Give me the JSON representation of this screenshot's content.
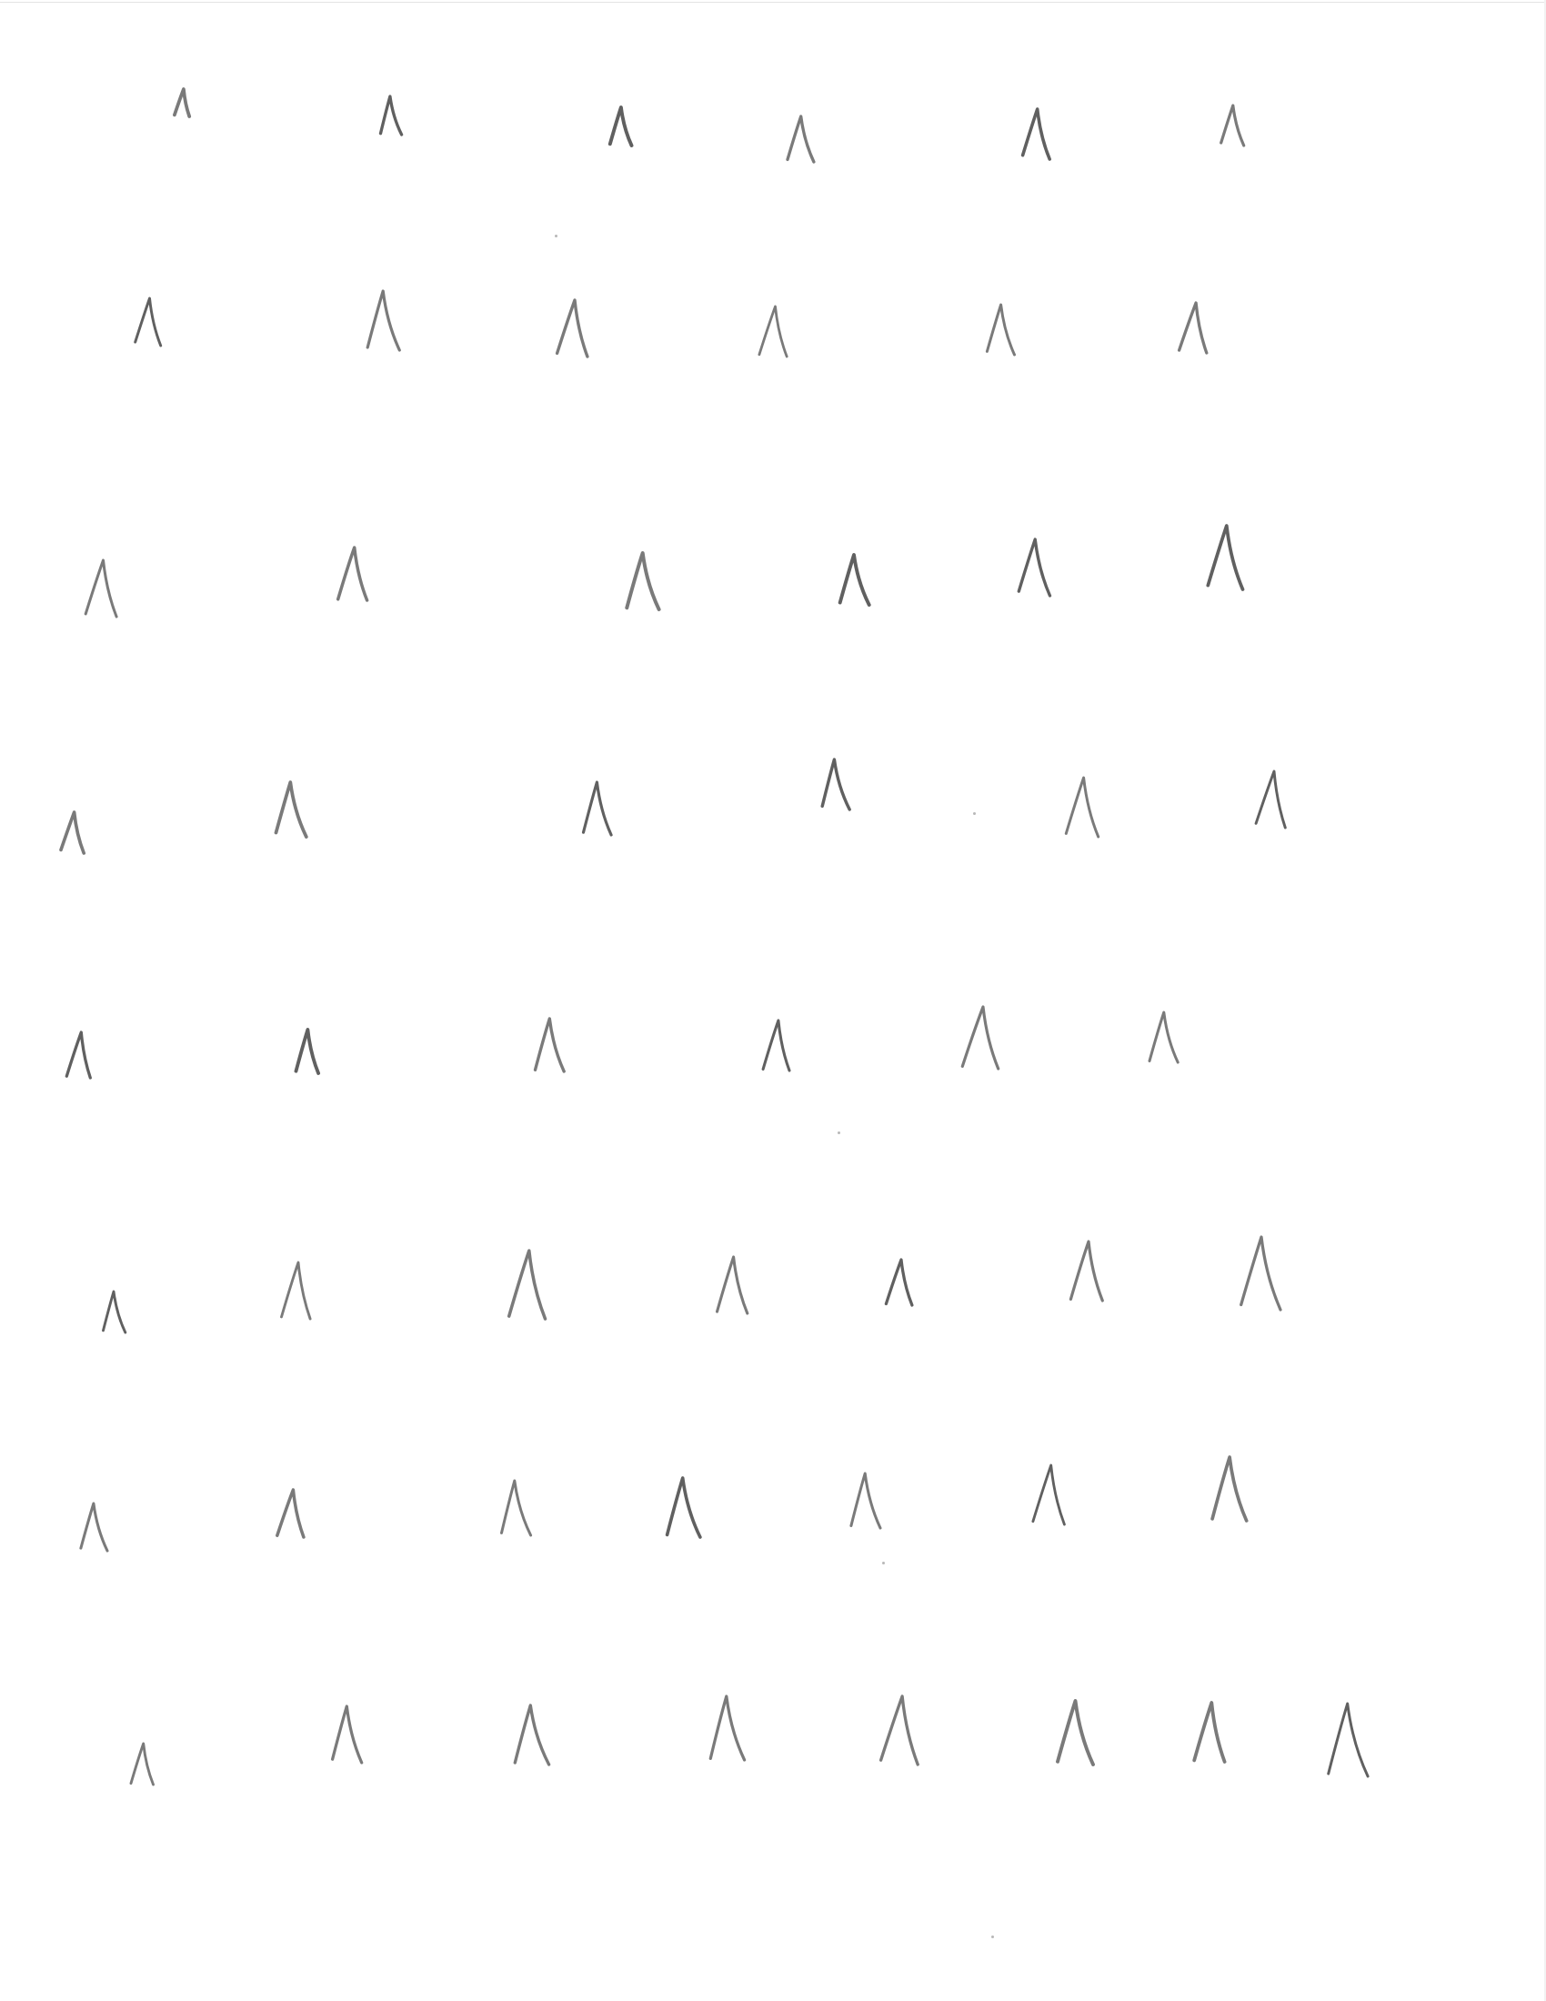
{
  "page": {
    "background_color": "#ffffff",
    "ink_color": "#7a7a7a",
    "ink_color_dark": "#606060"
  },
  "worksheet": {
    "symbol": "Λ",
    "rows": [
      {
        "count": 6
      },
      {
        "count": 6
      },
      {
        "count": 6
      },
      {
        "count": 6
      },
      {
        "count": 6
      },
      {
        "count": 7
      },
      {
        "count": 7
      },
      {
        "count": 8
      }
    ]
  }
}
